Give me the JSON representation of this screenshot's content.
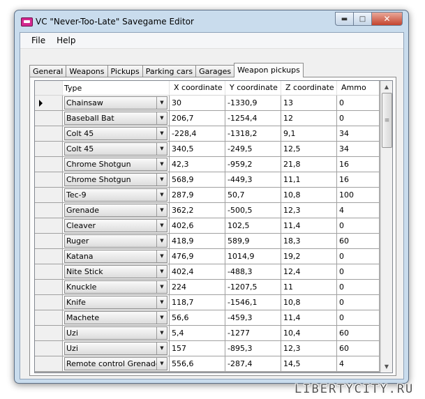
{
  "window": {
    "title": "VC \"Never-Too-Late\" Savegame Editor"
  },
  "menu": {
    "file": "File",
    "help": "Help"
  },
  "tabs": [
    "General",
    "Weapons",
    "Pickups",
    "Parking cars",
    "Garages",
    "Weapon pickups"
  ],
  "table": {
    "headers": {
      "type": "Type",
      "x": "X coordinate",
      "y": "Y coordinate",
      "z": "Z coordinate",
      "ammo": "Ammo"
    },
    "rows": [
      {
        "type": "Chainsaw",
        "x": "30",
        "y": "-1330,9",
        "z": "13",
        "ammo": "0"
      },
      {
        "type": "Baseball Bat",
        "x": "206,7",
        "y": "-1254,4",
        "z": "12",
        "ammo": "0"
      },
      {
        "type": "Colt 45",
        "x": "-228,4",
        "y": "-1318,2",
        "z": "9,1",
        "ammo": "34"
      },
      {
        "type": "Colt 45",
        "x": "340,5",
        "y": "-249,5",
        "z": "12,5",
        "ammo": "34"
      },
      {
        "type": "Chrome Shotgun",
        "x": "42,3",
        "y": "-959,2",
        "z": "21,8",
        "ammo": "16"
      },
      {
        "type": "Chrome Shotgun",
        "x": "568,9",
        "y": "-449,3",
        "z": "11,1",
        "ammo": "16"
      },
      {
        "type": "Tec-9",
        "x": "287,9",
        "y": "50,7",
        "z": "10,8",
        "ammo": "100"
      },
      {
        "type": "Grenade",
        "x": "362,2",
        "y": "-500,5",
        "z": "12,3",
        "ammo": "4"
      },
      {
        "type": "Cleaver",
        "x": "402,6",
        "y": "102,5",
        "z": "11,4",
        "ammo": "0"
      },
      {
        "type": "Ruger",
        "x": "418,9",
        "y": "589,9",
        "z": "18,3",
        "ammo": "60"
      },
      {
        "type": "Katana",
        "x": "476,9",
        "y": "1014,9",
        "z": "19,2",
        "ammo": "0"
      },
      {
        "type": "Nite Stick",
        "x": "402,4",
        "y": "-488,3",
        "z": "12,4",
        "ammo": "0"
      },
      {
        "type": "Knuckle",
        "x": "224",
        "y": "-1207,5",
        "z": "11",
        "ammo": "0"
      },
      {
        "type": "Knife",
        "x": "118,7",
        "y": "-1546,1",
        "z": "10,8",
        "ammo": "0"
      },
      {
        "type": "Machete",
        "x": "56,6",
        "y": "-459,3",
        "z": "11,4",
        "ammo": "0"
      },
      {
        "type": "Uzi",
        "x": "5,4",
        "y": "-1277",
        "z": "10,4",
        "ammo": "60"
      },
      {
        "type": "Uzi",
        "x": "157",
        "y": "-895,3",
        "z": "12,3",
        "ammo": "60"
      },
      {
        "type": "Remote control Grenade",
        "x": "556,6",
        "y": "-287,4",
        "z": "14,5",
        "ammo": "4"
      }
    ]
  },
  "watermark": "LIBERTYCITY.RU"
}
